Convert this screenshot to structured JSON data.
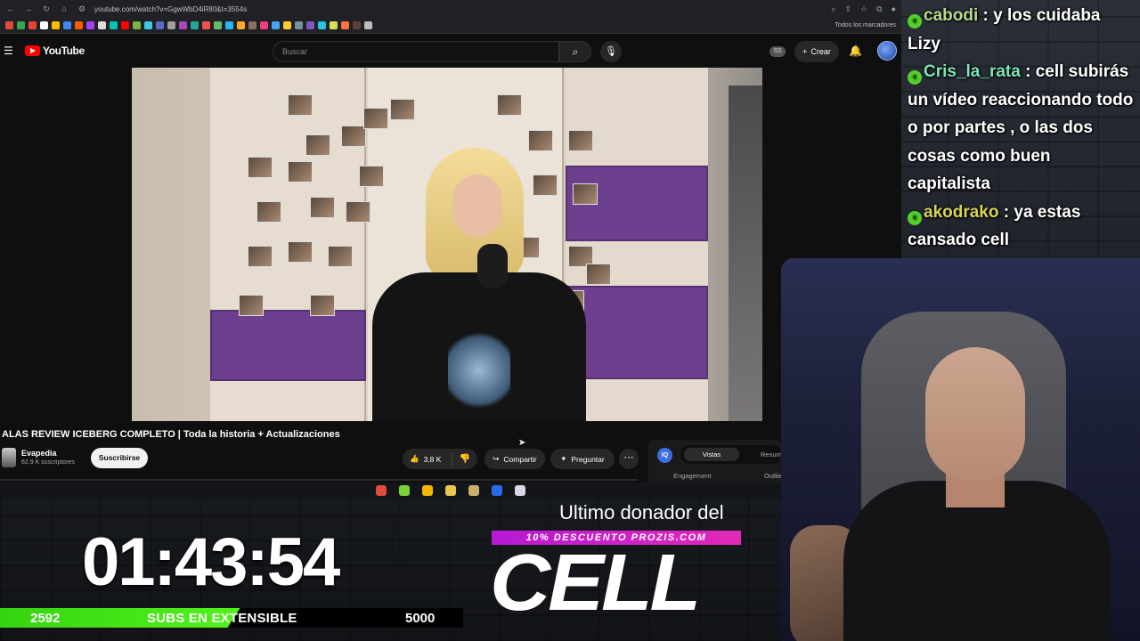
{
  "browser": {
    "url": "youtube.com/watch?v=GgwWbD4iR80&t=3554s",
    "bookmarks_all_label": "Todos los marcadores",
    "bookmark_colors": [
      "#e04a3a",
      "#34a853",
      "#ea4335",
      "#ffffff",
      "#fbbc05",
      "#4285f4",
      "#ff5c00",
      "#a142f4",
      "#dddddd",
      "#00c4b4",
      "#ff0000",
      "#7cb342",
      "#3ec6e0",
      "#5c6bc0",
      "#9e9e9e",
      "#ab47bc",
      "#26a69a",
      "#ef5350",
      "#66bb6a",
      "#29b6f6",
      "#ffa726",
      "#8d6e63",
      "#ec407a",
      "#42a5f5",
      "#ffca28",
      "#78909c",
      "#7e57c2",
      "#26c6da",
      "#d4e157",
      "#ff7043",
      "#5d4037",
      "#bdbdbd"
    ]
  },
  "youtube": {
    "logo_text": "YouTube",
    "search_placeholder": "Buscar",
    "ss_badge": "SS",
    "create_label": "Crear",
    "video_title": "ALAS REVIEW ICEBERG COMPLETO | Toda la historia + Actualizaciones",
    "channel_name": "Evapedia",
    "channel_subscribers": "62,9 K suscriptores",
    "subscribe_label": "Suscribirse",
    "likes": "3,8 K",
    "share_label": "Compartir",
    "ask_label": "Preguntar",
    "analytics": {
      "logo": "IQ",
      "tab_active": "Vistas",
      "tab_other": "Resum",
      "engagement_label": "Engagement",
      "outlier_label": "Outlie"
    }
  },
  "taskbar_icons": [
    "#e04a3a",
    "#7cd13b",
    "#f2b705",
    "#e8c64a",
    "#c9b06a",
    "#2a6ae8",
    "#d7d7e8"
  ],
  "overlay": {
    "countdown": "01:43:54",
    "subs_current": "2592",
    "subs_label": "SUBS EN EXTENSIBLE",
    "subs_goal": "5000",
    "subs_progress": 0.5184,
    "last_donor_label": "Ultimo donador del",
    "promo_text": "10% DESCUENTO PROZIS.COM",
    "last_donor_name": "CELL"
  },
  "chat": {
    "messages": [
      {
        "user": "cabodi",
        "text": "y los cuidaba Lizy"
      },
      {
        "user": "Cris_la_rata",
        "text": "cell subirás un vídeo reaccionando todo o por partes , o las dos cosas como buen capitalista"
      },
      {
        "user": "akodrako",
        "text": "ya estas cansado cell"
      }
    ]
  }
}
